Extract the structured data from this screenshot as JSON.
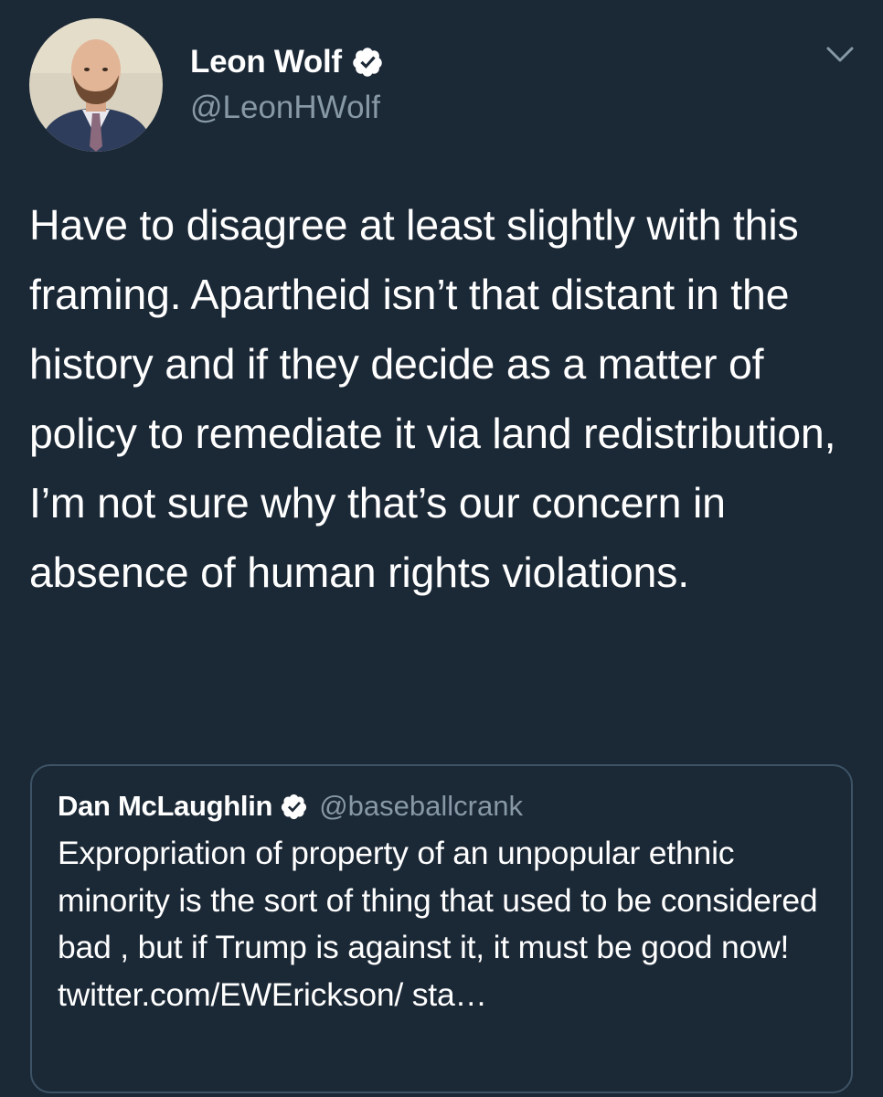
{
  "tweet": {
    "author": {
      "display_name": "Leon Wolf",
      "handle": "@LeonHWolf",
      "verified": true,
      "avatar_icon": "profile-photo"
    },
    "menu_icon": "chevron-down-icon",
    "text": "Have to disagree at least slightly with this framing. Apartheid isn’t that distant in the history and if they decide as a matter of policy to remediate it via land redistribution, I’m not sure why that’s our concern in absence of human rights violations.",
    "quoted_tweet": {
      "display_name": "Dan McLaughlin",
      "handle": "@baseballcrank",
      "verified": true,
      "text": "Expropriation of property of an unpopular ethnic minority is the sort of thing that used to be considered bad , but if Trump is against it, it must be good now! twitter.com/EWErickson/ sta…"
    }
  },
  "colors": {
    "background": "#1b2836",
    "text_primary": "#ffffff",
    "text_secondary": "#8899a6",
    "quote_border": "#3d5466",
    "verified_badge": "#ffffff"
  }
}
